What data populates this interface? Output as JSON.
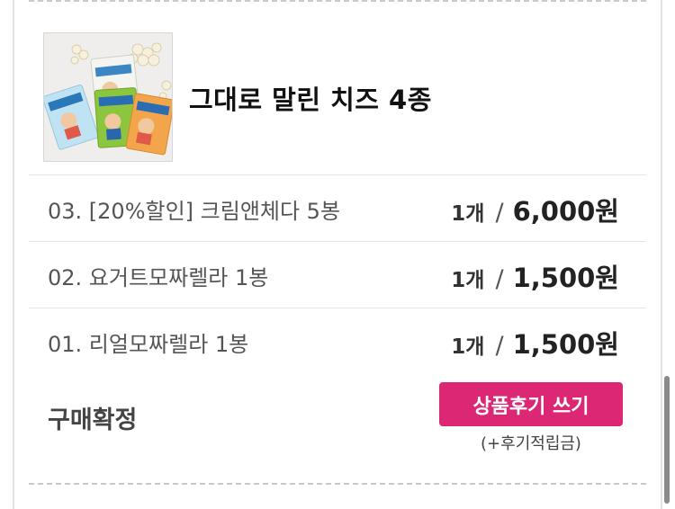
{
  "product": {
    "title": "그대로 말린 치즈 4종"
  },
  "options": [
    {
      "name": "03. [20%할인] 크림앤체다 5봉",
      "qty": "1개",
      "price": "6,000원"
    },
    {
      "name": "02. 요거트모짜렐라 1봉",
      "qty": "1개",
      "price": "1,500원"
    },
    {
      "name": "01. 리얼모짜렐라 1봉",
      "qty": "1개",
      "price": "1,500원"
    }
  ],
  "order_status": {
    "label": "구매확정",
    "review_button": "상품후기 쓰기",
    "review_note": "(+후기적립금)"
  },
  "separator": "/",
  "colors": {
    "accent": "#dc2874"
  }
}
